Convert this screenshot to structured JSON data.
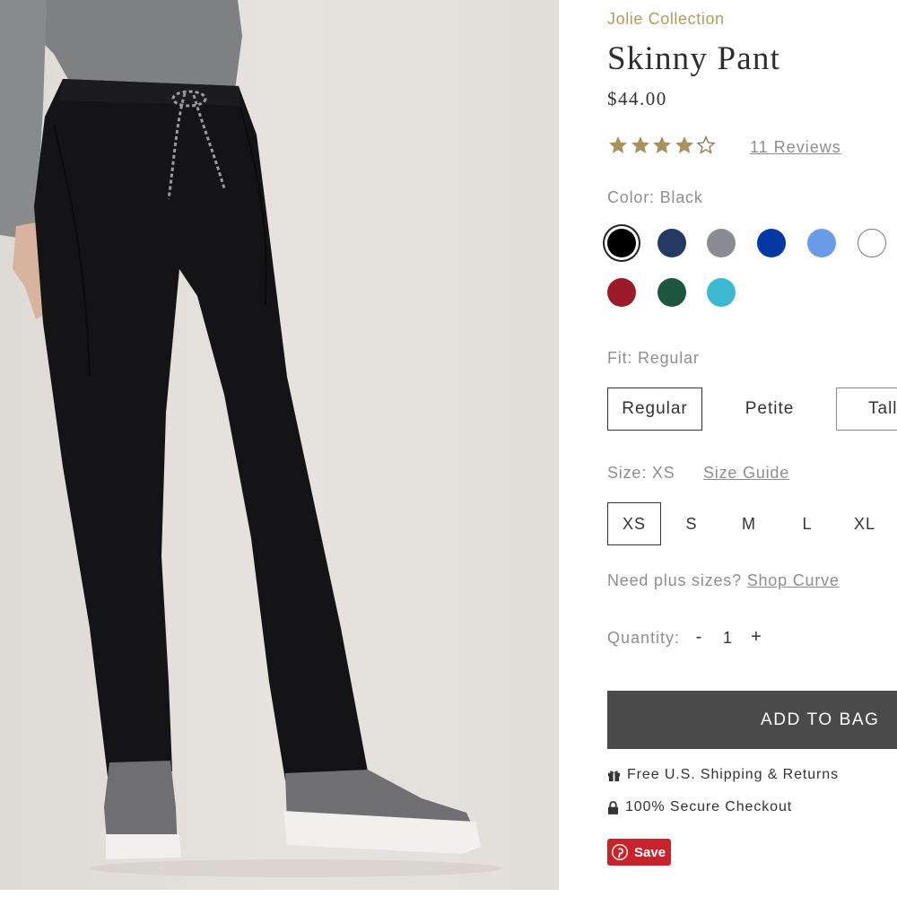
{
  "product": {
    "collection": "Jolie Collection",
    "title": "Skinny Pant",
    "price": "$44.00",
    "rating": 4,
    "rating_max": 5,
    "reviews_label": "11 Reviews"
  },
  "color": {
    "label": "Color: Black",
    "swatches": [
      {
        "name": "black",
        "hex": "#000000",
        "selected": true
      },
      {
        "name": "navy",
        "hex": "#253a63"
      },
      {
        "name": "grey",
        "hex": "#8a8b93"
      },
      {
        "name": "royal-blue",
        "hex": "#0638a5"
      },
      {
        "name": "ceil-blue",
        "hex": "#6a9be6"
      },
      {
        "name": "white",
        "hex": "#ffffff"
      },
      {
        "name": "burgundy",
        "hex": "#9b1b2a"
      },
      {
        "name": "hunter-green",
        "hex": "#1f5640"
      },
      {
        "name": "turquoise",
        "hex": "#3cb8d0"
      }
    ]
  },
  "fit": {
    "label": "Fit: Regular",
    "options": [
      "Regular",
      "Petite",
      "Tall"
    ],
    "selected": "Regular"
  },
  "size": {
    "label": "Size: XS",
    "guide_label": "Size Guide",
    "options": [
      "XS",
      "S",
      "M",
      "L",
      "XL"
    ],
    "selected": "XS",
    "plus_prompt": "Need plus sizes?",
    "plus_link": "Shop Curve"
  },
  "quantity": {
    "label": "Quantity:",
    "minus": "-",
    "value": "1",
    "plus": "+"
  },
  "cart": {
    "add_label": "ADD TO BAG"
  },
  "info": {
    "shipping": "Free U.S. Shipping & Returns",
    "secure": "100% Secure Checkout"
  },
  "pinterest": {
    "save_label": "Save"
  },
  "colors": {
    "accent_gold": "#b59a5f",
    "button_dark": "#4a4a4a",
    "pinterest_red": "#c8232c"
  }
}
